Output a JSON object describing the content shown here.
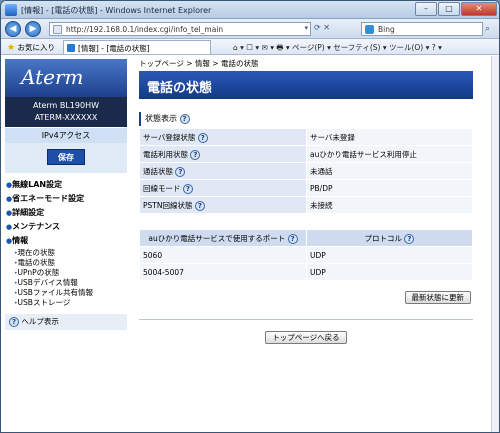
{
  "window": {
    "title": "[情報] - [電話の状態] - Windows Internet Explorer",
    "minimize": "–",
    "maximize": "□",
    "close": "✕"
  },
  "address": {
    "url": "http://192.168.0.1/index.cgi/info_tel_main",
    "search_placeholder": "Bing"
  },
  "favbar": {
    "favorites": "お気に入り",
    "tab": "[情報] - [電話の状態]",
    "commands": "⌂ ▾  ☐ ▾  ✉ ▾  🖶 ▾  ページ(P) ▾  セーフティ(S) ▾  ツール(O) ▾  ? ▾"
  },
  "sidebar": {
    "logo": "Aterm",
    "model_line1": "Aterm BL190HW",
    "model_line2": "ATERM-XXXXXX",
    "ipv4": "IPv4アクセス",
    "save": "保存",
    "menu": [
      {
        "label": "無線LAN設定"
      },
      {
        "label": "省エネーモード設定"
      },
      {
        "label": "詳細設定"
      },
      {
        "label": "メンテナンス"
      },
      {
        "label": "情報"
      }
    ],
    "submenu": [
      {
        "label": "現在の状態"
      },
      {
        "label": "電話の状態"
      },
      {
        "label": "UPnPの状態"
      },
      {
        "label": "USBデバイス情報"
      },
      {
        "label": "USBファイル共有情報"
      },
      {
        "label": "USBストレージ"
      }
    ],
    "help": "ヘルプ表示"
  },
  "main": {
    "breadcrumb": "トップページ > 情報 > 電話の状態",
    "title": "電話の状態",
    "section": "状態表示",
    "status_rows": [
      {
        "key": "サーバ登録状態",
        "value": "サーバ未登録"
      },
      {
        "key": "電話利用状態",
        "value": "auひかり電話サービス利用停止"
      },
      {
        "key": "通話状態",
        "value": "未通話"
      },
      {
        "key": "回線モード",
        "value": "PB/DP"
      },
      {
        "key": "PSTN回線状態",
        "value": "未接続"
      }
    ],
    "port_header_port": "auひかり電話サービスで使用するポート",
    "port_header_protocol": "プロトコル",
    "port_rows": [
      {
        "port": "5060",
        "protocol": "UDP"
      },
      {
        "port": "5004-5007",
        "protocol": "UDP"
      }
    ],
    "refresh_button": "最新状態に更新",
    "back_button": "トップページへ戻る"
  },
  "help_mark": "?"
}
